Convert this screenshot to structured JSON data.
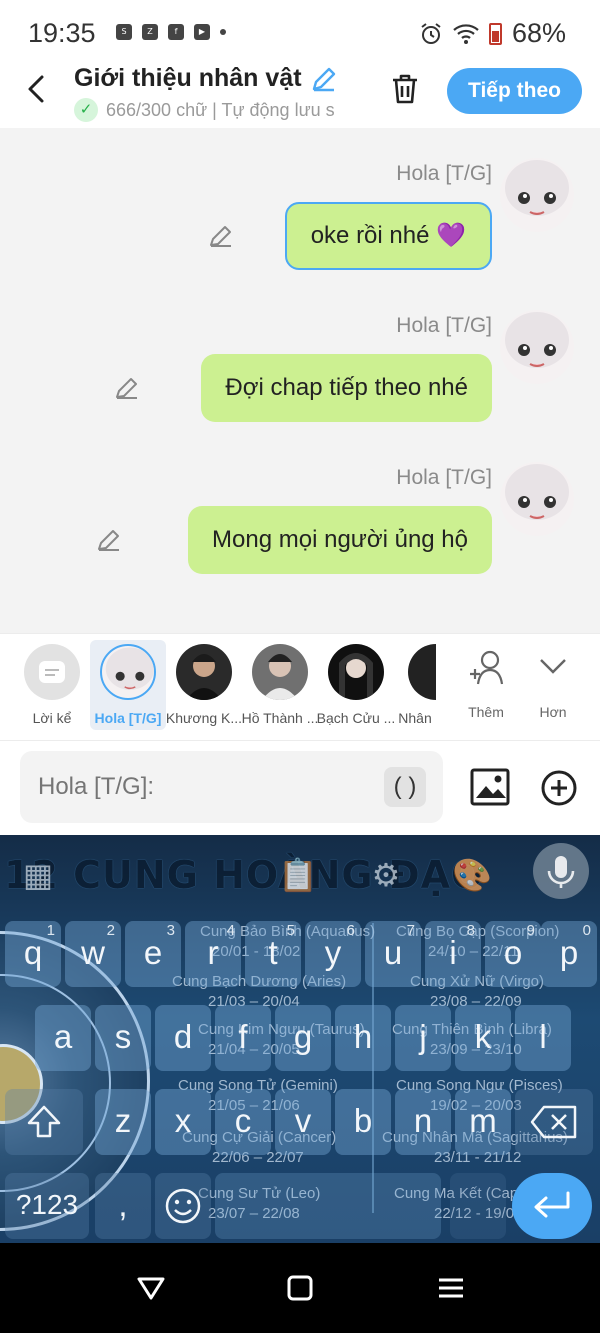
{
  "status_bar": {
    "time": "19:35",
    "battery": "68%",
    "app_icons": [
      "shopee-icon",
      "zalo-icon",
      "facebook-icon",
      "youtube-icon"
    ]
  },
  "header": {
    "title": "Giới thiệu nhân vật",
    "subtitle": "666/300 chữ | Tự động lưu s",
    "next_label": "Tiếp theo"
  },
  "messages": [
    {
      "sender": "Hola [T/G]",
      "text": "oke rồi nhé 💜",
      "selected": true
    },
    {
      "sender": "Hola [T/G]",
      "text": "Đợi chap tiếp theo nhé",
      "selected": false
    },
    {
      "sender": "Hola [T/G]",
      "text": "Mong mọi người ủng hộ",
      "selected": false
    }
  ],
  "characters": [
    {
      "label": "Lời kể"
    },
    {
      "label": "Hola [T/G]",
      "active": true
    },
    {
      "label": "Khương K..."
    },
    {
      "label": "Hồ Thành ..."
    },
    {
      "label": "Bạch Cửu ..."
    },
    {
      "label": "Nhân"
    }
  ],
  "tools": {
    "add_label": "Thêm",
    "more_label": "Hơn"
  },
  "input": {
    "placeholder": "Hola [T/G]:",
    "paren_label": "( )"
  },
  "keyboard": {
    "theme_title": "12 CUNG HOÀNG ĐẠO",
    "row1": [
      {
        "k": "q",
        "n": "1"
      },
      {
        "k": "w",
        "n": "2"
      },
      {
        "k": "e",
        "n": "3"
      },
      {
        "k": "r",
        "n": "4"
      },
      {
        "k": "t",
        "n": "5"
      },
      {
        "k": "y",
        "n": "6"
      },
      {
        "k": "u",
        "n": "7"
      },
      {
        "k": "i",
        "n": "8"
      },
      {
        "k": "o",
        "n": "9"
      },
      {
        "k": "p",
        "n": "0"
      }
    ],
    "row2": [
      "a",
      "s",
      "d",
      "f",
      "g",
      "h",
      "j",
      "k",
      "l"
    ],
    "row3": [
      "z",
      "x",
      "c",
      "v",
      "b",
      "n",
      "m"
    ],
    "sym_label": "?123",
    "comma_label": ",",
    "zodiac_lines": [
      "Cung Bảo Bình (Aquarius)",
      "20/01 - 18/02",
      "Cung Bạch Dương (Aries)",
      "21/03 – 20/04",
      "Cung Kim Ngưu (Taurus)",
      "21/04 – 20/05",
      "Cung Song Tử (Gemini)",
      "21/05 – 21/06",
      "Cung Cự Giải (Cancer)",
      "22/06 – 22/07",
      "Cung Sư Tử (Leo)",
      "23/07 – 22/08",
      "Cung Bọ Cạp (Scorpion)",
      "24/10 – 22/11",
      "Cung Xử Nữ (Virgo)",
      "23/08 – 22/09",
      "Cung Thiên Bình (Libra)",
      "23/09 – 23/10",
      "Cung Song Ngư (Pisces)",
      "19/02 – 20/03",
      "Cung Nhân Mã (Sagittarius)",
      "23/11 - 21/12",
      "Cung Ma Kết (Capricorn)",
      "22/12 - 19/01"
    ]
  },
  "colors": {
    "accent": "#4ba8f4",
    "bubble": "#ccf091",
    "chat_bg": "#f3f3f3"
  }
}
